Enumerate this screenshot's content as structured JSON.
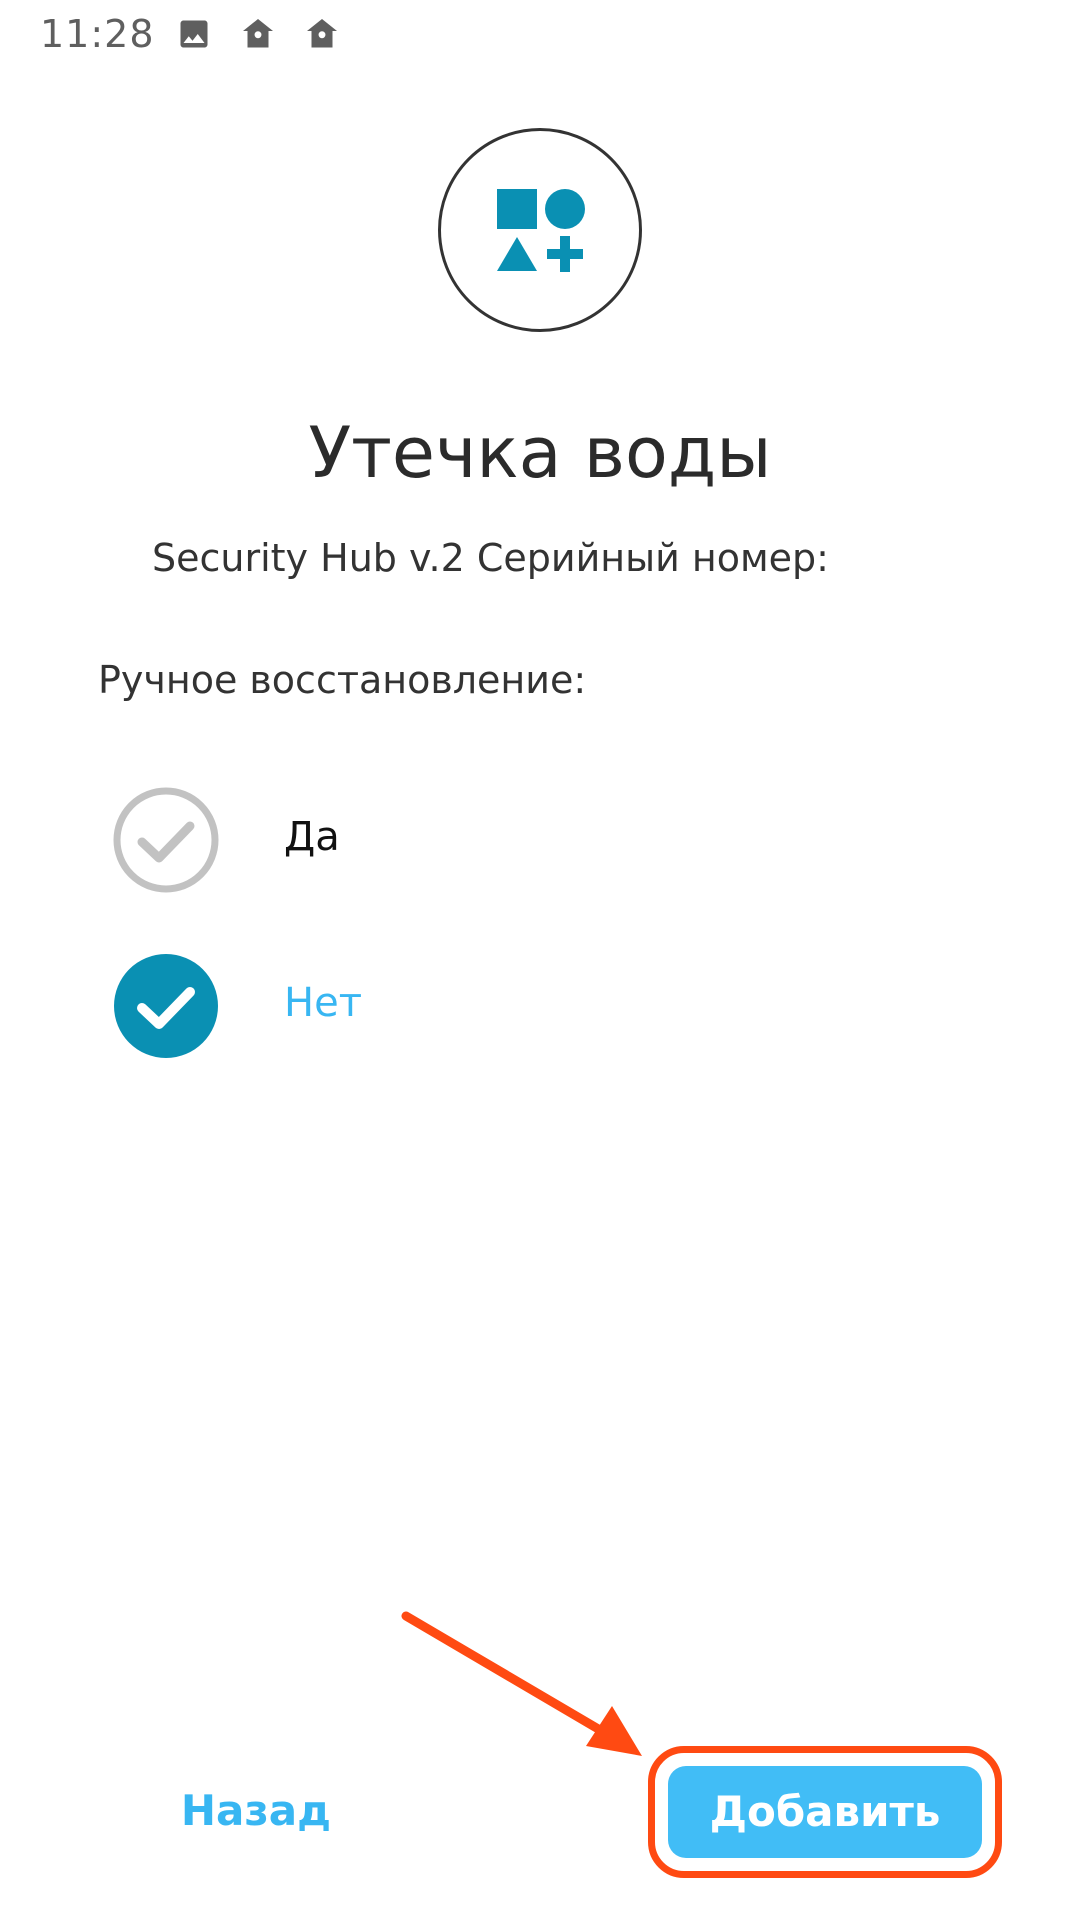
{
  "status_bar": {
    "time": "11:28",
    "icons": [
      "image-icon",
      "home-icon",
      "home-icon"
    ]
  },
  "device": {
    "icon": "shapes-icon",
    "accent_color": "#0a90b3",
    "title": "Утечка воды",
    "serial_label": "Security Hub v.2 Серийный номер:"
  },
  "settings": {
    "manual_restore_label": "Ручное восстановление:",
    "options": [
      {
        "label": "Да",
        "selected": false
      },
      {
        "label": "Нет",
        "selected": true
      }
    ]
  },
  "footer": {
    "back_label": "Назад",
    "add_label": "Добавить"
  },
  "colors": {
    "accent": "#41bdf6",
    "selected": "#0a90b3",
    "highlight": "#ff4a12"
  }
}
